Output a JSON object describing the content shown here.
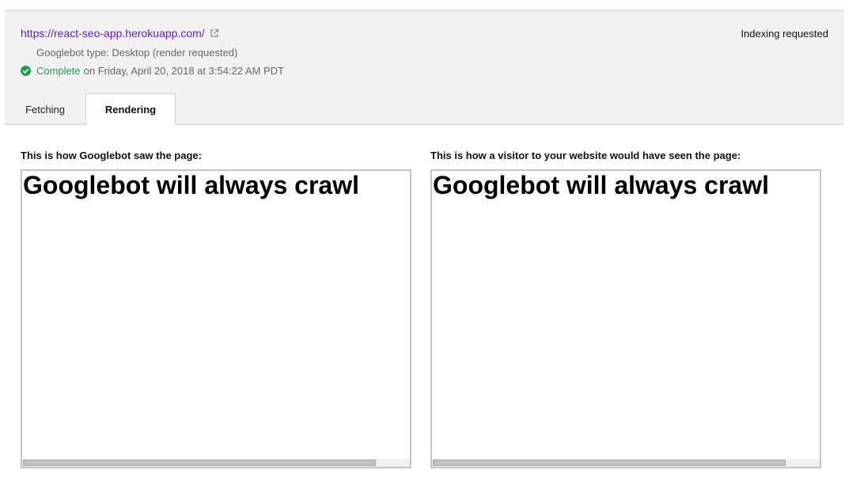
{
  "header": {
    "url": "https://react-seo-app.herokuapp.com/",
    "status": "Indexing requested",
    "bot_type": "Googlebot type: Desktop (render requested)",
    "complete_label": "Complete",
    "complete_detail": "on Friday, April 20, 2018 at 3:54:22 AM PDT",
    "accent_color": "#6a1fb3",
    "success_color": "#1e9e4a"
  },
  "tabs": [
    {
      "label": "Fetching",
      "active": false
    },
    {
      "label": "Rendering",
      "active": true
    }
  ],
  "panels": {
    "googlebot": {
      "caption": "This is how Googlebot saw the page:",
      "heading": "Googlebot will always crawl"
    },
    "visitor": {
      "caption": "This is how a visitor to your website would have seen the page:",
      "heading": "Googlebot will always crawl"
    }
  },
  "icons": [
    "external-link-icon",
    "check-circle-icon"
  ]
}
